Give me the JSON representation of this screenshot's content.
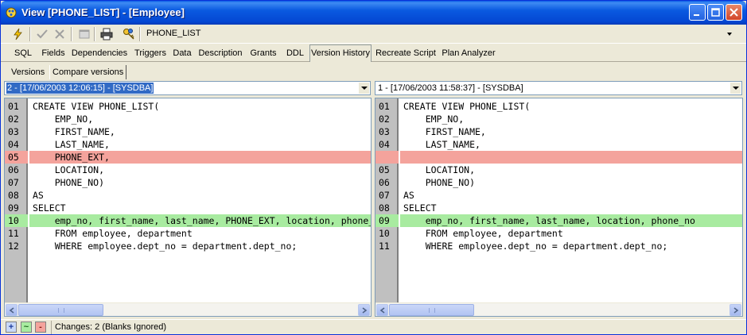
{
  "window": {
    "title": "View [PHONE_LIST] - [Employee]"
  },
  "toolbar": {
    "object_name": "PHONE_LIST",
    "icons": [
      "compile-lightning-icon",
      "commit-check-icon",
      "rollback-x-icon",
      "window-icon",
      "printer-icon",
      "keys-icon"
    ]
  },
  "tabs": [
    {
      "label": "SQL"
    },
    {
      "label": "Fields"
    },
    {
      "label": "Dependencies"
    },
    {
      "label": "Triggers"
    },
    {
      "label": "Data"
    },
    {
      "label": "Description"
    },
    {
      "label": "Grants"
    },
    {
      "label": "DDL"
    },
    {
      "label": "Version History"
    },
    {
      "label": "Recreate Script"
    },
    {
      "label": "Plan Analyzer"
    }
  ],
  "subtabs": [
    {
      "label": "Versions"
    },
    {
      "label": "Compare versions"
    }
  ],
  "left": {
    "version": "2 - [17/06/2003 12:06:15] - [SYSDBA]",
    "lines": [
      {
        "num": "01",
        "text": "CREATE VIEW PHONE_LIST(",
        "state": "same"
      },
      {
        "num": "02",
        "text": "    EMP_NO,",
        "state": "same"
      },
      {
        "num": "03",
        "text": "    FIRST_NAME,",
        "state": "same"
      },
      {
        "num": "04",
        "text": "    LAST_NAME,",
        "state": "same"
      },
      {
        "num": "05",
        "text": "    PHONE_EXT,",
        "state": "removed"
      },
      {
        "num": "06",
        "text": "    LOCATION,",
        "state": "same"
      },
      {
        "num": "07",
        "text": "    PHONE_NO)",
        "state": "same"
      },
      {
        "num": "08",
        "text": "AS",
        "state": "same"
      },
      {
        "num": "09",
        "text": "SELECT",
        "state": "same"
      },
      {
        "num": "10",
        "text": "    emp_no, first_name, last_name, PHONE_EXT, location, phone_no",
        "state": "changed"
      },
      {
        "num": "11",
        "text": "    FROM employee, department",
        "state": "same"
      },
      {
        "num": "12",
        "text": "    WHERE employee.dept_no = department.dept_no;",
        "state": "same"
      }
    ]
  },
  "right": {
    "version": "1 - [17/06/2003 11:58:37] - [SYSDBA]",
    "lines": [
      {
        "num": "01",
        "text": "CREATE VIEW PHONE_LIST(",
        "state": "same"
      },
      {
        "num": "02",
        "text": "    EMP_NO,",
        "state": "same"
      },
      {
        "num": "03",
        "text": "    FIRST_NAME,",
        "state": "same"
      },
      {
        "num": "04",
        "text": "    LAST_NAME,",
        "state": "same"
      },
      {
        "num": "",
        "text": "",
        "state": "removed"
      },
      {
        "num": "05",
        "text": "    LOCATION,",
        "state": "same"
      },
      {
        "num": "06",
        "text": "    PHONE_NO)",
        "state": "same"
      },
      {
        "num": "07",
        "text": "AS",
        "state": "same"
      },
      {
        "num": "08",
        "text": "SELECT",
        "state": "same"
      },
      {
        "num": "09",
        "text": "    emp_no, first_name, last_name, location, phone_no",
        "state": "changed"
      },
      {
        "num": "10",
        "text": "    FROM employee, department",
        "state": "same"
      },
      {
        "num": "11",
        "text": "    WHERE employee.dept_no = department.dept_no;",
        "state": "same"
      }
    ]
  },
  "status": {
    "add_symbol": "+",
    "change_symbol": "~",
    "remove_symbol": "-",
    "text": "Changes: 2  (Blanks Ignored)"
  },
  "colors": {
    "removed": "#f4a39c",
    "changed": "#a8eba0",
    "titlebar": "#0a5ae0"
  }
}
